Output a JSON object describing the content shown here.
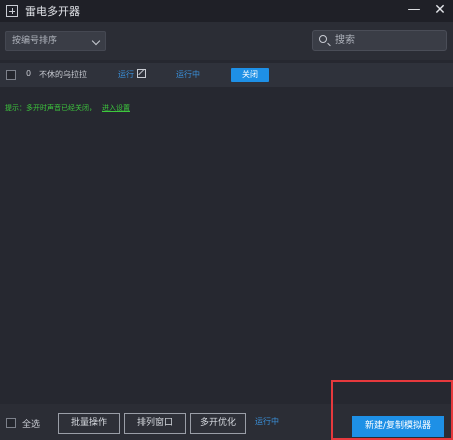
{
  "window": {
    "title": "雷电多开器",
    "minimize_label": "—",
    "close_label": "✕"
  },
  "toolbar": {
    "sort_selected": "按编号排序",
    "search_placeholder": "搜索"
  },
  "instances": [
    {
      "index": "0",
      "name": "不休的乌拉拉",
      "action_link": "运行",
      "status": "运行中",
      "close_label": "关闭"
    }
  ],
  "tip": {
    "text": "提示：多开时声音已经关闭，",
    "link": "进入设置"
  },
  "footer": {
    "select_all": "全选",
    "batch_label": "批量操作",
    "arrange_label": "排列窗口",
    "optimize_label": "多开优化",
    "status_text": "运行中",
    "create_label": "新建/复制模拟器"
  },
  "colors": {
    "accent": "#1e90e6",
    "tip": "#3dc83d",
    "highlight": "#e6393d",
    "background": "#2b2d35"
  },
  "icons": [
    "app-icon",
    "chevron-down-icon",
    "search-icon",
    "edit-icon"
  ]
}
